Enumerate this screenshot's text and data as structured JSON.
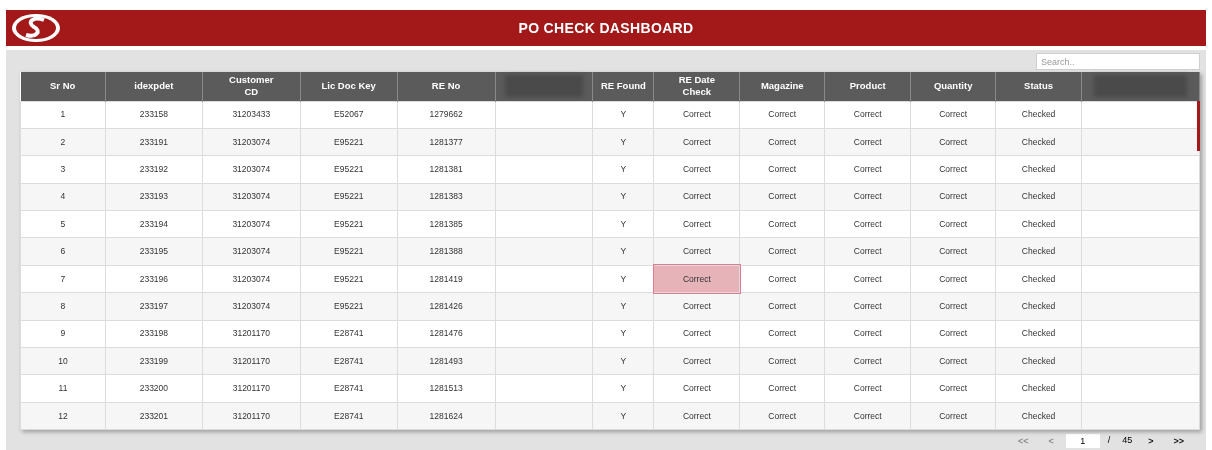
{
  "header": {
    "title": "PO CHECK DASHBOARD"
  },
  "search": {
    "placeholder": "Search.."
  },
  "table": {
    "columns": [
      {
        "kind": "text",
        "label": "Sr No"
      },
      {
        "kind": "text",
        "label": "idexpdet"
      },
      {
        "kind": "text",
        "label": "Customer CD"
      },
      {
        "kind": "text",
        "label": "Lic Doc Key"
      },
      {
        "kind": "text",
        "label": "RE No"
      },
      {
        "kind": "blurred"
      },
      {
        "kind": "text",
        "label": "RE Found"
      },
      {
        "kind": "text",
        "label": "RE Date Check"
      },
      {
        "kind": "text",
        "label": "Magazine"
      },
      {
        "kind": "text",
        "label": "Product"
      },
      {
        "kind": "text",
        "label": "Quantity"
      },
      {
        "kind": "text",
        "label": "Status"
      },
      {
        "kind": "blurred"
      }
    ],
    "rows": [
      {
        "cells": [
          "1",
          "233158",
          "31203433",
          "E52067",
          "1279662",
          null,
          "Y",
          "Correct",
          "Correct",
          "Correct",
          "Correct",
          "Checked",
          null
        ],
        "selected_cells": [
          false,
          false,
          false,
          false,
          false,
          false,
          false,
          false,
          false,
          false,
          false,
          false,
          false
        ]
      },
      {
        "cells": [
          "2",
          "233191",
          "31203074",
          "E95221",
          "1281377",
          null,
          "Y",
          "Correct",
          "Correct",
          "Correct",
          "Correct",
          "Checked",
          null
        ],
        "selected_cells": [
          false,
          false,
          false,
          false,
          false,
          false,
          false,
          false,
          false,
          false,
          false,
          false,
          false
        ]
      },
      {
        "cells": [
          "3",
          "233192",
          "31203074",
          "E95221",
          "1281381",
          null,
          "Y",
          "Correct",
          "Correct",
          "Correct",
          "Correct",
          "Checked",
          null
        ],
        "selected_cells": [
          false,
          false,
          false,
          false,
          false,
          false,
          false,
          false,
          false,
          false,
          false,
          false,
          false
        ]
      },
      {
        "cells": [
          "4",
          "233193",
          "31203074",
          "E95221",
          "1281383",
          null,
          "Y",
          "Correct",
          "Correct",
          "Correct",
          "Correct",
          "Checked",
          null
        ],
        "selected_cells": [
          false,
          false,
          false,
          false,
          false,
          false,
          false,
          false,
          false,
          false,
          false,
          false,
          false
        ]
      },
      {
        "cells": [
          "5",
          "233194",
          "31203074",
          "E95221",
          "1281385",
          null,
          "Y",
          "Correct",
          "Correct",
          "Correct",
          "Correct",
          "Checked",
          null
        ],
        "selected_cells": [
          false,
          false,
          false,
          false,
          false,
          false,
          false,
          false,
          false,
          false,
          false,
          false,
          false
        ]
      },
      {
        "cells": [
          "6",
          "233195",
          "31203074",
          "E95221",
          "1281388",
          null,
          "Y",
          "Correct",
          "Correct",
          "Correct",
          "Correct",
          "Checked",
          null
        ],
        "selected_cells": [
          false,
          false,
          false,
          false,
          false,
          false,
          false,
          false,
          false,
          false,
          false,
          false,
          false
        ]
      },
      {
        "cells": [
          "7",
          "233196",
          "31203074",
          "E95221",
          "1281419",
          null,
          "Y",
          "Correct",
          "Correct",
          "Correct",
          "Correct",
          "Checked",
          null
        ],
        "selected_cells": [
          false,
          false,
          false,
          false,
          false,
          false,
          false,
          true,
          false,
          false,
          false,
          false,
          false
        ]
      },
      {
        "cells": [
          "8",
          "233197",
          "31203074",
          "E95221",
          "1281426",
          null,
          "Y",
          "Correct",
          "Correct",
          "Correct",
          "Correct",
          "Checked",
          null
        ],
        "selected_cells": [
          false,
          false,
          false,
          false,
          false,
          false,
          false,
          false,
          false,
          false,
          false,
          false,
          false
        ]
      },
      {
        "cells": [
          "9",
          "233198",
          "31201170",
          "E28741",
          "1281476",
          null,
          "Y",
          "Correct",
          "Correct",
          "Correct",
          "Correct",
          "Checked",
          null
        ],
        "selected_cells": [
          false,
          false,
          false,
          false,
          false,
          false,
          false,
          false,
          false,
          false,
          false,
          false,
          false
        ]
      },
      {
        "cells": [
          "10",
          "233199",
          "31201170",
          "E28741",
          "1281493",
          null,
          "Y",
          "Correct",
          "Correct",
          "Correct",
          "Correct",
          "Checked",
          null
        ],
        "selected_cells": [
          false,
          false,
          false,
          false,
          false,
          false,
          false,
          false,
          false,
          false,
          false,
          false,
          false
        ]
      },
      {
        "cells": [
          "11",
          "233200",
          "31201170",
          "E28741",
          "1281513",
          null,
          "Y",
          "Correct",
          "Correct",
          "Correct",
          "Correct",
          "Checked",
          null
        ],
        "selected_cells": [
          false,
          false,
          false,
          false,
          false,
          false,
          false,
          false,
          false,
          false,
          false,
          false,
          false
        ]
      },
      {
        "cells": [
          "12",
          "233201",
          "31201170",
          "E28741",
          "1281624",
          null,
          "Y",
          "Correct",
          "Correct",
          "Correct",
          "Correct",
          "Checked",
          null
        ],
        "selected_cells": [
          false,
          false,
          false,
          false,
          false,
          false,
          false,
          false,
          false,
          false,
          false,
          false,
          false
        ]
      }
    ]
  },
  "pagination": {
    "buttons": [
      {
        "label": "<<",
        "disabled": true
      },
      {
        "label": "<",
        "disabled": true
      }
    ],
    "page": "1",
    "separator": "/",
    "total": "45",
    "next_buttons": [
      {
        "label": ">",
        "disabled": false
      },
      {
        "label": ">>",
        "disabled": false
      }
    ]
  }
}
